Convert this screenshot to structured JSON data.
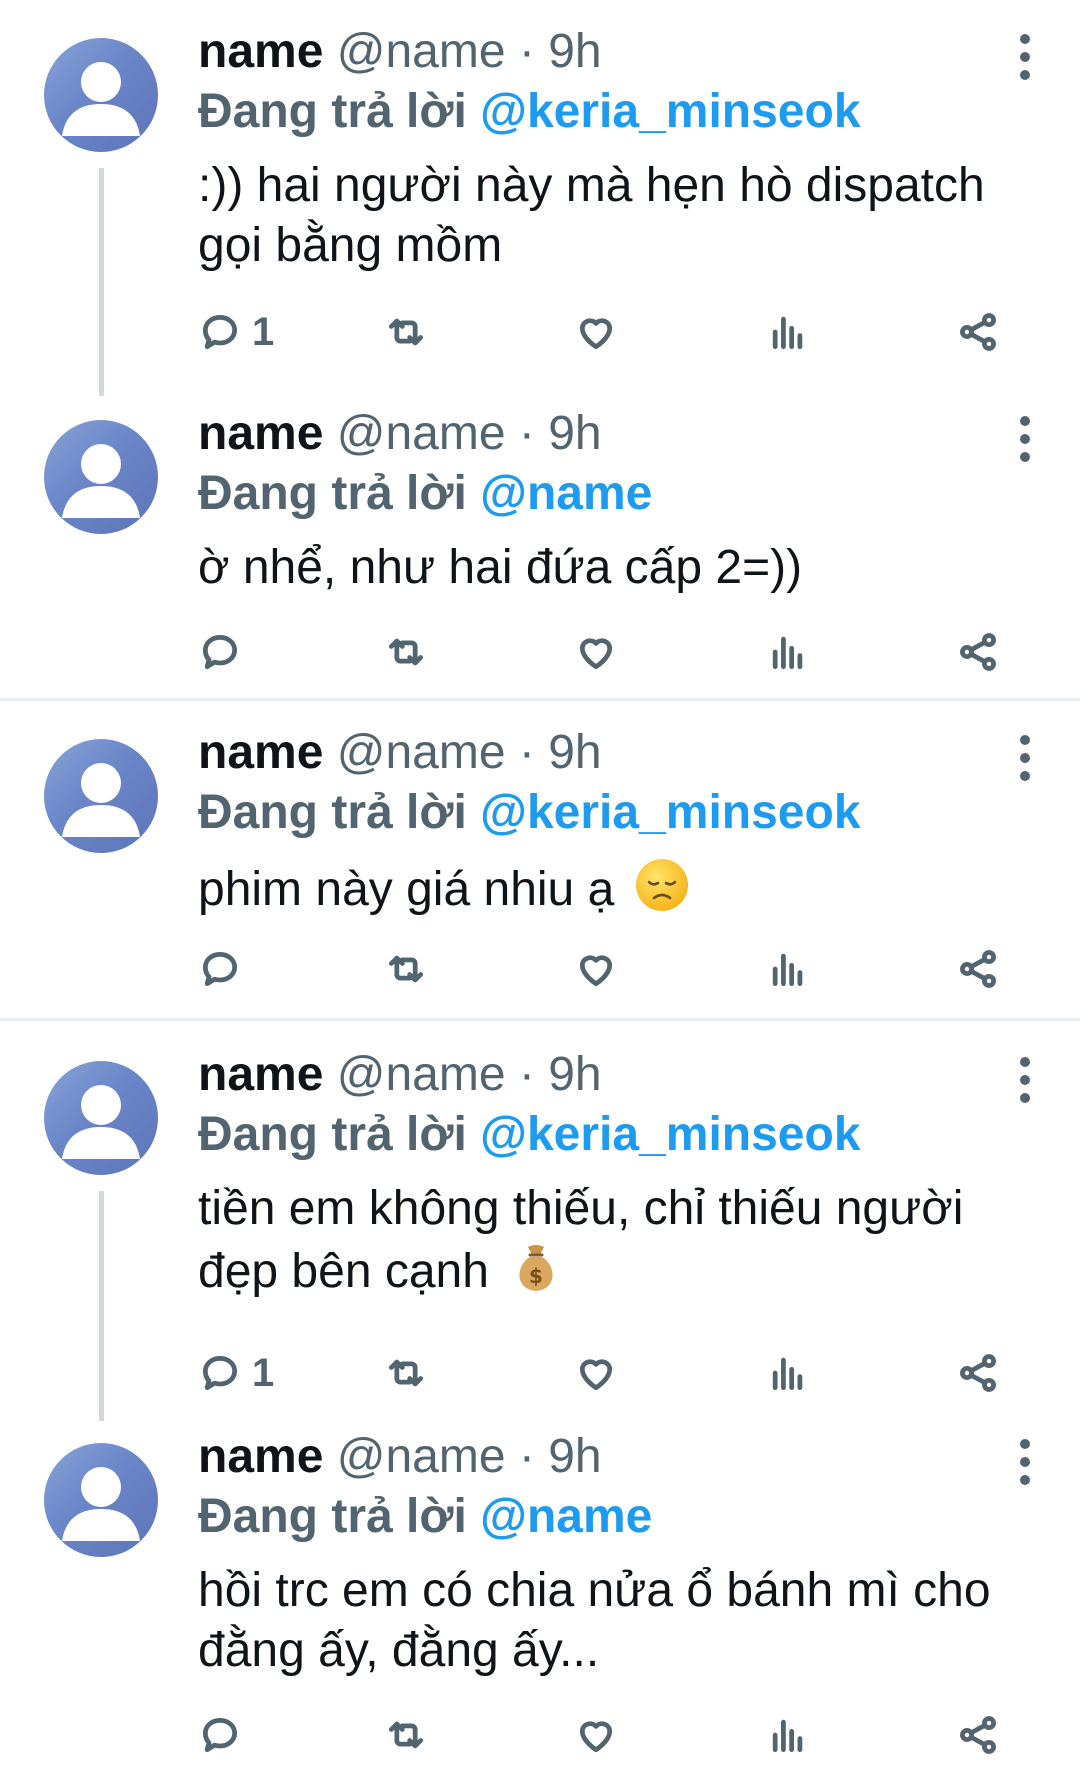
{
  "colors": {
    "name": "#0f1419",
    "muted": "#536471",
    "mention": "#1d9bf0",
    "divider": "#e6ecf0"
  },
  "icons": [
    "reply-icon",
    "retweet-icon",
    "like-icon",
    "views-icon",
    "share-icon",
    "more-icon",
    "avatar-default-icon"
  ],
  "tweets": [
    {
      "name": "name",
      "handle": "@name",
      "dot": "·",
      "time": "9h",
      "reply_prefix": "Đang trả lời",
      "mention": "@keria_minseok",
      "text": ":)) hai người này mà hẹn hò dispatch gọi bằng mồm",
      "reply_count": "1"
    },
    {
      "name": "name",
      "handle": "@name",
      "dot": "·",
      "time": "9h",
      "reply_prefix": "Đang trả lời",
      "mention": "@name",
      "text": "ờ nhể, như hai đứa cấp 2=))",
      "reply_count": ""
    },
    {
      "name": "name",
      "handle": "@name",
      "dot": "·",
      "time": "9h",
      "reply_prefix": "Đang trả lời",
      "mention": "@keria_minseok",
      "text": "phim này giá nhiu ạ",
      "emoji": "disappointed-face-emoji",
      "reply_count": ""
    },
    {
      "name": "name",
      "handle": "@name",
      "dot": "·",
      "time": "9h",
      "reply_prefix": "Đang trả lời",
      "mention": "@keria_minseok",
      "text": "tiền em không thiếu, chỉ thiếu người đẹp bên cạnh",
      "emoji": "money-bag-emoji",
      "reply_count": "1"
    },
    {
      "name": "name",
      "handle": "@name",
      "dot": "·",
      "time": "9h",
      "reply_prefix": "Đang trả lời",
      "mention": "@name",
      "text": "hồi trc em có chia nửa ổ bánh mì cho đằng ấy, đằng ấy...",
      "reply_count": ""
    }
  ]
}
